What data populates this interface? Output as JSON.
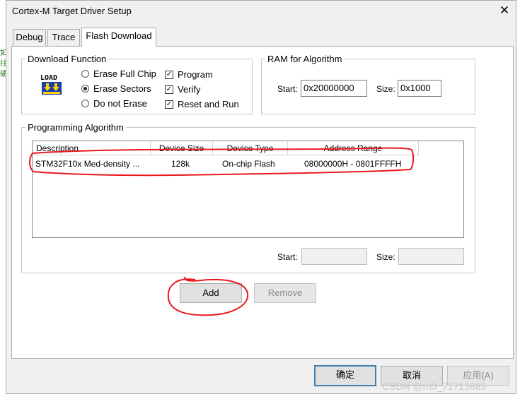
{
  "window": {
    "title": "Cortex-M Target Driver Setup",
    "close_label": "✕"
  },
  "left_strip": [
    "如",
    "拄",
    "硬"
  ],
  "tabs": [
    {
      "label": "Debug"
    },
    {
      "label": "Trace"
    },
    {
      "label": "Flash Download"
    }
  ],
  "download_function": {
    "legend": "Download Function",
    "load_icon_text": "LOAD",
    "radios": [
      {
        "label": "Erase Full Chip",
        "selected": false
      },
      {
        "label": "Erase Sectors",
        "selected": true
      },
      {
        "label": "Do not Erase",
        "selected": false
      }
    ],
    "checkboxes": [
      {
        "label": "Program",
        "checked": true
      },
      {
        "label": "Verify",
        "checked": true
      },
      {
        "label": "Reset and Run",
        "checked": true
      }
    ]
  },
  "ram": {
    "legend": "RAM for Algorithm",
    "start_label": "Start:",
    "start_value": "0x20000000",
    "size_label": "Size:",
    "size_value": "0x1000"
  },
  "programming": {
    "legend": "Programming Algorithm",
    "columns": [
      "Description",
      "Device Size",
      "Device Type",
      "Address Range"
    ],
    "rows": [
      {
        "description": "STM32F10x Med-density ...",
        "size": "128k",
        "type": "On-chip Flash",
        "range": "08000000H - 0801FFFFH"
      }
    ],
    "start_label": "Start:",
    "start_value": "",
    "size_label": "Size:",
    "size_value": ""
  },
  "buttons": {
    "add": "Add",
    "remove": "Remove"
  },
  "footer": {
    "ok": "确定",
    "cancel": "取消",
    "apply": "应用(A)"
  },
  "watermark": "CSDN @m0_71713885",
  "annotation_color": "#e8191c"
}
